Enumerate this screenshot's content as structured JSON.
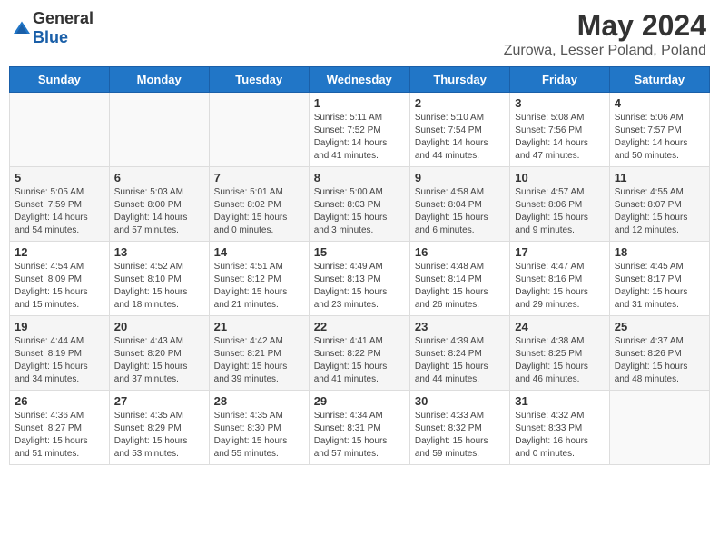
{
  "header": {
    "logo_general": "General",
    "logo_blue": "Blue",
    "month_title": "May 2024",
    "location": "Zurowa, Lesser Poland, Poland"
  },
  "weekdays": [
    "Sunday",
    "Monday",
    "Tuesday",
    "Wednesday",
    "Thursday",
    "Friday",
    "Saturday"
  ],
  "weeks": [
    [
      {
        "day": "",
        "info": ""
      },
      {
        "day": "",
        "info": ""
      },
      {
        "day": "",
        "info": ""
      },
      {
        "day": "1",
        "info": "Sunrise: 5:11 AM\nSunset: 7:52 PM\nDaylight: 14 hours\nand 41 minutes."
      },
      {
        "day": "2",
        "info": "Sunrise: 5:10 AM\nSunset: 7:54 PM\nDaylight: 14 hours\nand 44 minutes."
      },
      {
        "day": "3",
        "info": "Sunrise: 5:08 AM\nSunset: 7:56 PM\nDaylight: 14 hours\nand 47 minutes."
      },
      {
        "day": "4",
        "info": "Sunrise: 5:06 AM\nSunset: 7:57 PM\nDaylight: 14 hours\nand 50 minutes."
      }
    ],
    [
      {
        "day": "5",
        "info": "Sunrise: 5:05 AM\nSunset: 7:59 PM\nDaylight: 14 hours\nand 54 minutes."
      },
      {
        "day": "6",
        "info": "Sunrise: 5:03 AM\nSunset: 8:00 PM\nDaylight: 14 hours\nand 57 minutes."
      },
      {
        "day": "7",
        "info": "Sunrise: 5:01 AM\nSunset: 8:02 PM\nDaylight: 15 hours\nand 0 minutes."
      },
      {
        "day": "8",
        "info": "Sunrise: 5:00 AM\nSunset: 8:03 PM\nDaylight: 15 hours\nand 3 minutes."
      },
      {
        "day": "9",
        "info": "Sunrise: 4:58 AM\nSunset: 8:04 PM\nDaylight: 15 hours\nand 6 minutes."
      },
      {
        "day": "10",
        "info": "Sunrise: 4:57 AM\nSunset: 8:06 PM\nDaylight: 15 hours\nand 9 minutes."
      },
      {
        "day": "11",
        "info": "Sunrise: 4:55 AM\nSunset: 8:07 PM\nDaylight: 15 hours\nand 12 minutes."
      }
    ],
    [
      {
        "day": "12",
        "info": "Sunrise: 4:54 AM\nSunset: 8:09 PM\nDaylight: 15 hours\nand 15 minutes."
      },
      {
        "day": "13",
        "info": "Sunrise: 4:52 AM\nSunset: 8:10 PM\nDaylight: 15 hours\nand 18 minutes."
      },
      {
        "day": "14",
        "info": "Sunrise: 4:51 AM\nSunset: 8:12 PM\nDaylight: 15 hours\nand 21 minutes."
      },
      {
        "day": "15",
        "info": "Sunrise: 4:49 AM\nSunset: 8:13 PM\nDaylight: 15 hours\nand 23 minutes."
      },
      {
        "day": "16",
        "info": "Sunrise: 4:48 AM\nSunset: 8:14 PM\nDaylight: 15 hours\nand 26 minutes."
      },
      {
        "day": "17",
        "info": "Sunrise: 4:47 AM\nSunset: 8:16 PM\nDaylight: 15 hours\nand 29 minutes."
      },
      {
        "day": "18",
        "info": "Sunrise: 4:45 AM\nSunset: 8:17 PM\nDaylight: 15 hours\nand 31 minutes."
      }
    ],
    [
      {
        "day": "19",
        "info": "Sunrise: 4:44 AM\nSunset: 8:19 PM\nDaylight: 15 hours\nand 34 minutes."
      },
      {
        "day": "20",
        "info": "Sunrise: 4:43 AM\nSunset: 8:20 PM\nDaylight: 15 hours\nand 37 minutes."
      },
      {
        "day": "21",
        "info": "Sunrise: 4:42 AM\nSunset: 8:21 PM\nDaylight: 15 hours\nand 39 minutes."
      },
      {
        "day": "22",
        "info": "Sunrise: 4:41 AM\nSunset: 8:22 PM\nDaylight: 15 hours\nand 41 minutes."
      },
      {
        "day": "23",
        "info": "Sunrise: 4:39 AM\nSunset: 8:24 PM\nDaylight: 15 hours\nand 44 minutes."
      },
      {
        "day": "24",
        "info": "Sunrise: 4:38 AM\nSunset: 8:25 PM\nDaylight: 15 hours\nand 46 minutes."
      },
      {
        "day": "25",
        "info": "Sunrise: 4:37 AM\nSunset: 8:26 PM\nDaylight: 15 hours\nand 48 minutes."
      }
    ],
    [
      {
        "day": "26",
        "info": "Sunrise: 4:36 AM\nSunset: 8:27 PM\nDaylight: 15 hours\nand 51 minutes."
      },
      {
        "day": "27",
        "info": "Sunrise: 4:35 AM\nSunset: 8:29 PM\nDaylight: 15 hours\nand 53 minutes."
      },
      {
        "day": "28",
        "info": "Sunrise: 4:35 AM\nSunset: 8:30 PM\nDaylight: 15 hours\nand 55 minutes."
      },
      {
        "day": "29",
        "info": "Sunrise: 4:34 AM\nSunset: 8:31 PM\nDaylight: 15 hours\nand 57 minutes."
      },
      {
        "day": "30",
        "info": "Sunrise: 4:33 AM\nSunset: 8:32 PM\nDaylight: 15 hours\nand 59 minutes."
      },
      {
        "day": "31",
        "info": "Sunrise: 4:32 AM\nSunset: 8:33 PM\nDaylight: 16 hours\nand 0 minutes."
      },
      {
        "day": "",
        "info": ""
      }
    ]
  ]
}
